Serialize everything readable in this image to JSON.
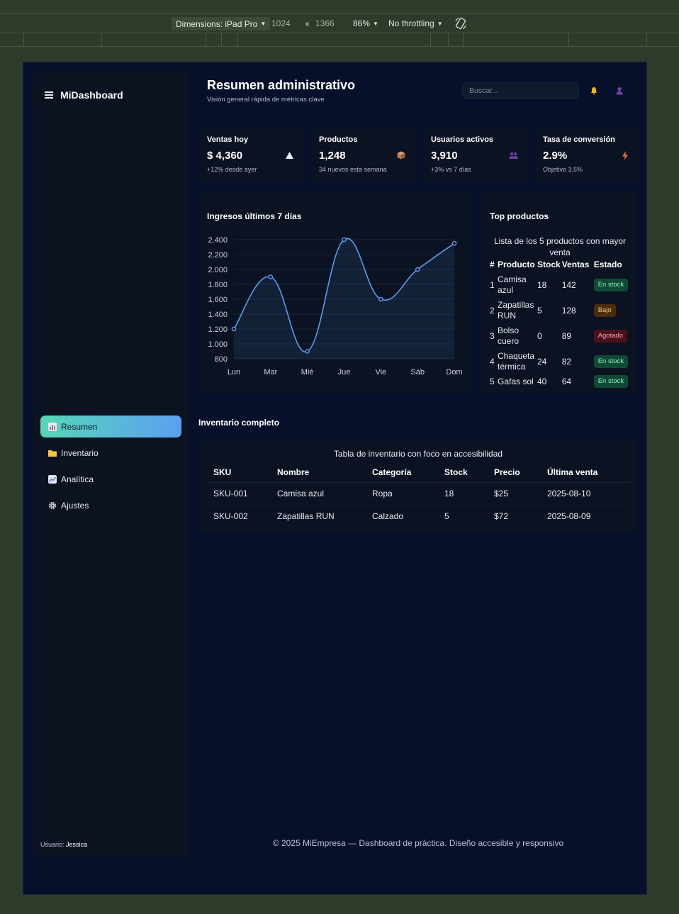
{
  "devtools": {
    "dimensions_label": "Dimensions: iPad Pro",
    "width": "1024",
    "times": "×",
    "height": "1366",
    "zoom": "86%",
    "throttling": "No throttling"
  },
  "sidebar": {
    "brand": "MiDashboard",
    "items": [
      {
        "label": "Resumen",
        "icon": "bar-chart-icon",
        "color": "#7c8ad6"
      },
      {
        "label": "Inventario",
        "icon": "folder-icon",
        "color": "#f4c542"
      },
      {
        "label": "Analítica",
        "icon": "trend-chart-icon",
        "color": "#9fb4d8"
      },
      {
        "label": "Ajustes",
        "icon": "gear-icon",
        "color": "#c8ced8"
      }
    ],
    "user_prefix": "Usuario: ",
    "user_name": "Jessica"
  },
  "header": {
    "title": "Resumen administrativo",
    "subtitle": "Visión general rápida de métricas clave",
    "search_placeholder": "Buscar..."
  },
  "stats": [
    {
      "title": "Ventas hoy",
      "value": "$ 4,360",
      "note": "+12% desde ayer",
      "icon": "triangle-up-icon"
    },
    {
      "title": "Productos",
      "value": "1,248",
      "note": "34 nuevos esta semana",
      "icon": "box-icon"
    },
    {
      "title": "Usuarios activos",
      "value": "3,910",
      "note": "+3% vs 7 días",
      "icon": "users-icon"
    },
    {
      "title": "Tasa de conversión",
      "value": "2.9%",
      "note": "Objetivo 3.5%",
      "icon": "bolt-icon"
    }
  ],
  "chart_data": {
    "type": "line",
    "title": "Ingresos últimos 7 días",
    "categories": [
      "Lun",
      "Mar",
      "Mié",
      "Jue",
      "Vie",
      "Sáb",
      "Dom"
    ],
    "values": [
      1200,
      1900,
      900,
      2400,
      1600,
      2000,
      2350
    ],
    "ylim": [
      800,
      2400
    ],
    "yticks": [
      "2.400",
      "2.200",
      "2.000",
      "1.800",
      "1.600",
      "1.400",
      "1.200",
      "1.000",
      "800"
    ],
    "ytick_values": [
      2400,
      2200,
      2000,
      1800,
      1600,
      1400,
      1200,
      1000,
      800
    ],
    "color": "#5b9cf0",
    "grid": true
  },
  "top_products": {
    "title": "Top productos",
    "caption": "Lista de los 5 productos con mayor venta",
    "headers": [
      "#",
      "Producto",
      "Stock",
      "Ventas",
      "Estado"
    ],
    "rows": [
      {
        "n": "1",
        "name": "Camisa azul",
        "stock": "18",
        "sales": "142",
        "status": "En stock",
        "kind": "ok"
      },
      {
        "n": "2",
        "name": "Zapatillas RUN",
        "stock": "5",
        "sales": "128",
        "status": "Bajo",
        "kind": "low"
      },
      {
        "n": "3",
        "name": "Bolso cuero",
        "stock": "0",
        "sales": "89",
        "status": "Agotado",
        "kind": "out"
      },
      {
        "n": "4",
        "name": "Chaqueta térmica",
        "stock": "24",
        "sales": "82",
        "status": "En stock",
        "kind": "ok"
      },
      {
        "n": "5",
        "name": "Gafas sol",
        "stock": "40",
        "sales": "64",
        "status": "En stock",
        "kind": "ok"
      }
    ]
  },
  "inventory": {
    "heading": "Inventario completo",
    "caption": "Tabla de inventario con foco en accesibilidad",
    "headers": [
      "SKU",
      "Nombre",
      "Categoría",
      "Stock",
      "Precio",
      "Última venta"
    ],
    "rows": [
      [
        "SKU-001",
        "Camisa azul",
        "Ropa",
        "18",
        "$25",
        "2025-08-10"
      ],
      [
        "SKU-002",
        "Zapatillas RUN",
        "Calzado",
        "5",
        "$72",
        "2025-08-09"
      ]
    ]
  },
  "footer": "© 2025 MiEmpresa — Dashboard de práctica. Diseño accesible y responsivo"
}
